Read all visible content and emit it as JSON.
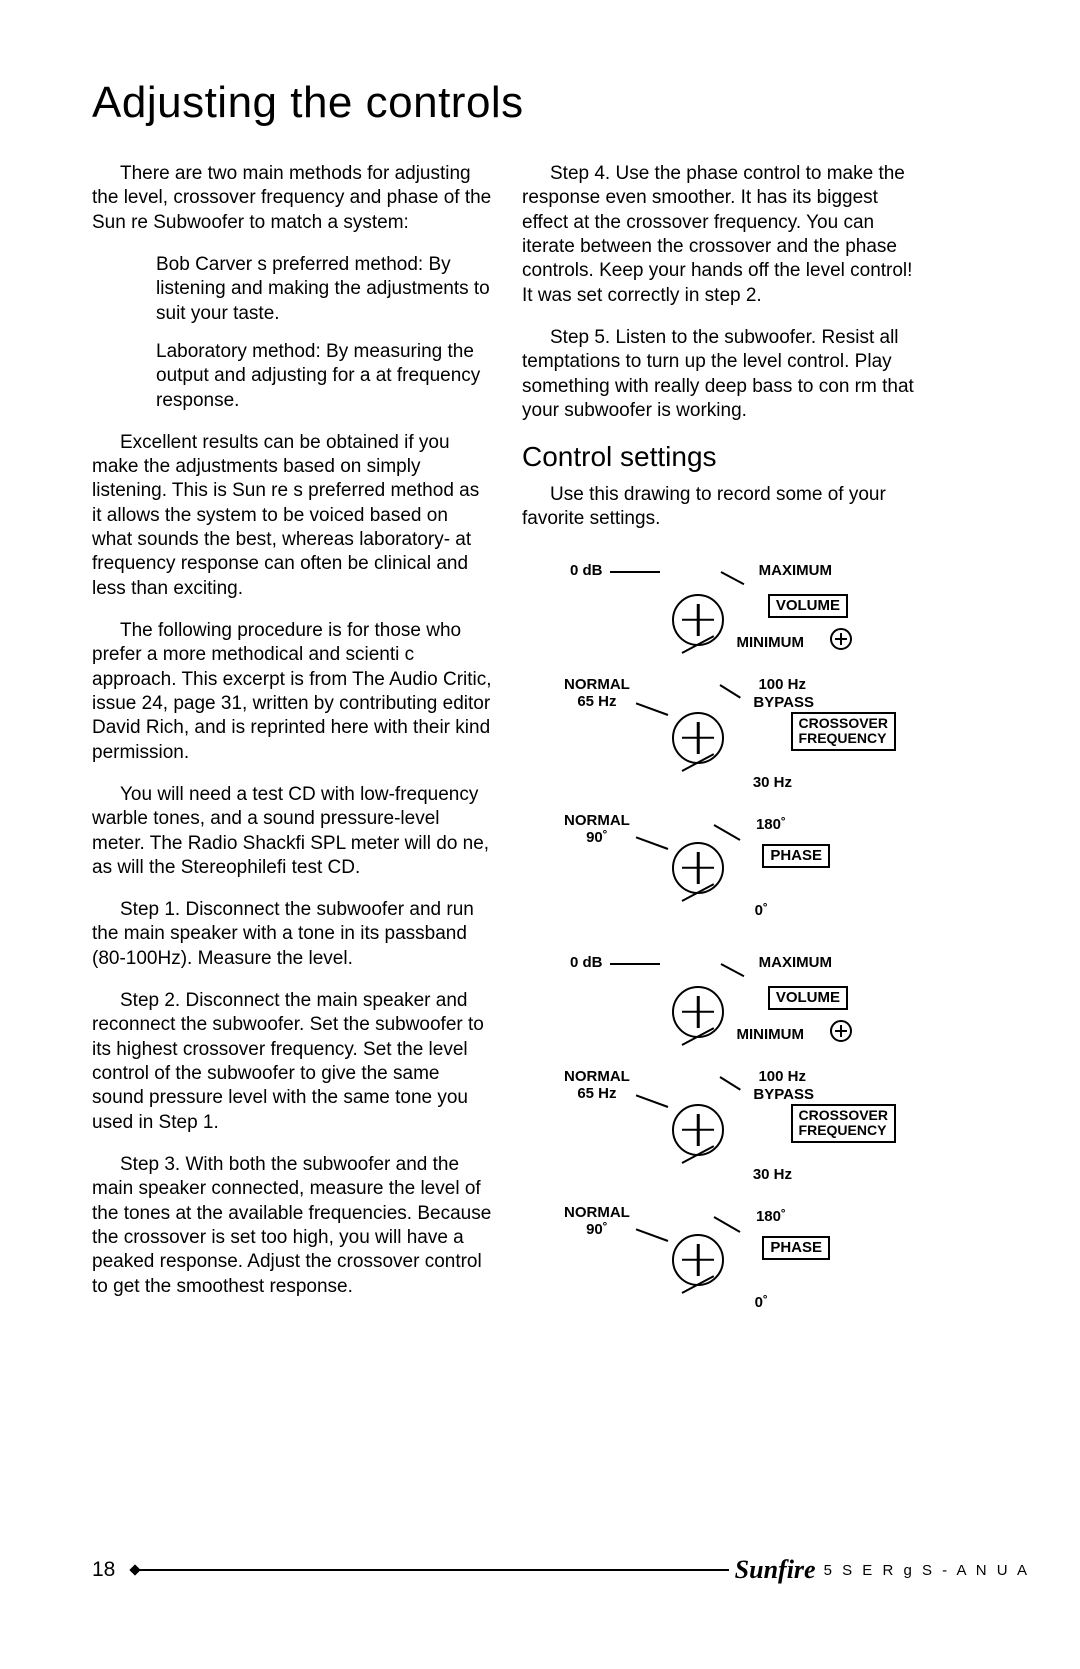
{
  "title": "Adjusting the controls",
  "left": {
    "p1": "There are two main methods for adjust­ing the level, crossover frequency and phase of the Sun re Subwoofer to match a system:",
    "method1": "Bob Carver s preferred method: By listening and making the adjustments to suit your taste.",
    "method2": "Laboratory method: By measuring the output and adjusting for a  at frequency response.",
    "p2": "Excellent results can be obtained if you make the adjustments based on simply listening. This is Sun re s preferred meth­od as it allows the system to be voiced based on what sounds the best, whereas laboratory- at frequency response can often be clinical and less than exciting.",
    "p3": "The following procedure is for those who prefer a more methodical and scien­ti c approach. This excerpt is from  The Audio Critic,  issue 24, page 31, written by contributing editor David Rich, and is reprinted here with their kind permission.",
    "p4": "You will need a test CD with low-fre­quency warble tones, and a sound pres­sure-level meter. The Radio Shackﬁ SPL meter will do  ne, as will the Stereophileﬁ test CD.",
    "s1": " Step 1.  Disconnect the subwoofer and run the main speaker with a tone in its passband (80-100Hz). Measure the level.",
    "s2": "Step 2.  Disconnect the main speaker and reconnect the subwoofer. Set the subwoofer to its highest crossover frequency. Set the level control of the subwoofer to give the same sound pres­sure level with the same tone you used in Step 1.",
    "s3": "Step 3.  With both the subwoofer and the main speaker connected, measure the level of the tones at the available frequencies.  Because the crossover is set too high, you will have a peaked response. Adjust the crossover control to get the smoothest response."
  },
  "right": {
    "s4": "Step 4.  Use the phase control to make the response even smoother. It has its biggest effect at the crossover frequency. You can iterate between the crossover and the phase controls. Keep your hands off the level control! It was set correctly in step 2.",
    "s5": "Step 5.  Listen to the subwoofer. Resist all temptations to turn up the level control. Play something with really deep bass to con rm that your subwoofer is working.",
    "subhead": "Control settings",
    "subp": "Use this drawing to record some of your favorite settings."
  },
  "dials": {
    "volume": {
      "tl": "0 dB",
      "tr": "MAXIMUM",
      "box": "VOLUME",
      "br": "MINIMUM"
    },
    "crossover": {
      "tl": "NORMAL",
      "tl2": "65 Hz",
      "tr": "100 Hz",
      "tr2": "BYPASS",
      "box": "CROSSOVER\nFREQUENCY",
      "br": "30 Hz"
    },
    "phase": {
      "tl": "NORMAL",
      "tl2": "90˚",
      "tr": "180˚",
      "box": "PHASE",
      "br": "0˚"
    }
  },
  "footer": {
    "page": "18",
    "brand": "Sunfire",
    "text": "5 S E R g S   - A N U A"
  }
}
